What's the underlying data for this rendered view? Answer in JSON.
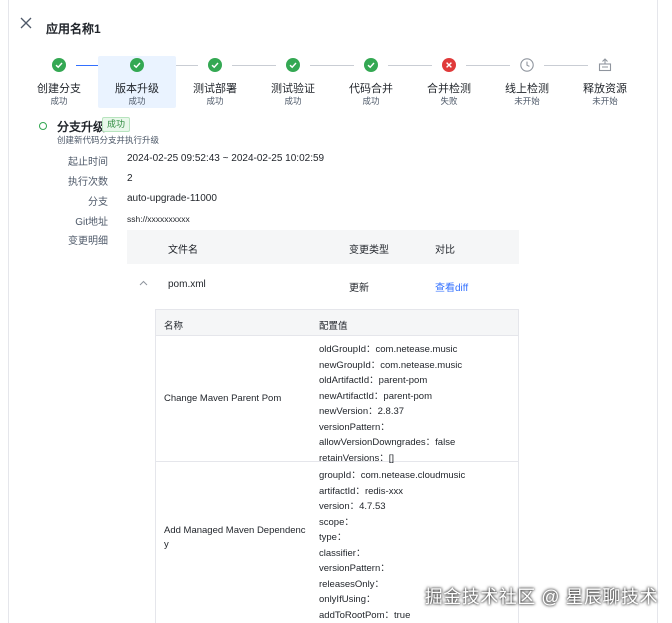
{
  "header": {
    "title": "应用名称1"
  },
  "steps": [
    {
      "name": "创建分支",
      "status": "成功",
      "state": "success",
      "icon": "check-circle-icon"
    },
    {
      "name": "版本升级",
      "status": "成功",
      "state": "success",
      "icon": "check-circle-icon"
    },
    {
      "name": "测试部署",
      "status": "成功",
      "state": "success",
      "icon": "check-circle-icon"
    },
    {
      "name": "测试验证",
      "status": "成功",
      "state": "success",
      "icon": "check-circle-icon"
    },
    {
      "name": "代码合并",
      "status": "成功",
      "state": "success",
      "icon": "check-circle-icon"
    },
    {
      "name": "合并检测",
      "status": "失败",
      "state": "failed",
      "icon": "error-circle-icon"
    },
    {
      "name": "线上检测",
      "status": "未开始",
      "state": "pending",
      "icon": "clock-icon"
    },
    {
      "name": "释放资源",
      "status": "未开始",
      "state": "pending",
      "icon": "release-icon"
    }
  ],
  "section": {
    "title": "分支升级",
    "badge": "成功",
    "desc": "创建新代码分支并执行升级"
  },
  "details": [
    {
      "label": "起止时间",
      "value": "2024-02-25 09:52:43 ~ 2024-02-25 10:02:59"
    },
    {
      "label": "执行次数",
      "value": "2"
    },
    {
      "label": "分支",
      "value": "auto-upgrade-11000"
    },
    {
      "label": "Git地址",
      "value": "ssh://xxxxxxxxxx"
    },
    {
      "label": "变更明细",
      "value": ""
    }
  ],
  "file_table": {
    "headers": [
      "文件名",
      "变更类型",
      "对比"
    ],
    "rows": [
      {
        "file": "pom.xml",
        "type": "更新",
        "diff": "查看diff"
      }
    ]
  },
  "cfg_table": {
    "headers": [
      "名称",
      "配置值"
    ],
    "rows": [
      {
        "name": "Change Maven Parent Pom",
        "lines": [
          {
            "k": "oldGroupId：",
            "v": "com.netease.music"
          },
          {
            "k": "newGroupId：",
            "v": "com.netease.music"
          },
          {
            "k": "oldArtifactId：",
            "v": "parent-pom"
          },
          {
            "k": "newArtifactId：",
            "v": "parent-pom"
          },
          {
            "k": "newVersion：",
            "v": "2.8.37"
          },
          {
            "k": "versionPattern：",
            "v": ""
          },
          {
            "k": "allowVersionDowngrades：",
            "v": "false"
          },
          {
            "k": "retainVersions：",
            "v": "[]"
          }
        ]
      },
      {
        "name_line1": "Add Managed Maven Dependenc",
        "name_line2": "y",
        "lines": [
          {
            "k": "groupId：",
            "v": "com.netease.cloudmusic"
          },
          {
            "k": "artifactId：",
            "v": "redis-xxx"
          },
          {
            "k": "version：",
            "v": "4.7.53"
          },
          {
            "k": "scope：",
            "v": ""
          },
          {
            "k": "type：",
            "v": ""
          },
          {
            "k": "classifier：",
            "v": ""
          },
          {
            "k": "versionPattern：",
            "v": ""
          },
          {
            "k": "releasesOnly：",
            "v": ""
          },
          {
            "k": "onlyIfUsing：",
            "v": ""
          },
          {
            "k": "addToRootPom：",
            "v": "true"
          }
        ]
      }
    ]
  },
  "watermark": "掘金技术社区 @ 星辰聊技术",
  "colors": {
    "success": "#34a853",
    "failed": "#e03a3a",
    "pending": "#8f959e",
    "accent": "#3370ff",
    "active_bg": "#eaf3ff"
  }
}
